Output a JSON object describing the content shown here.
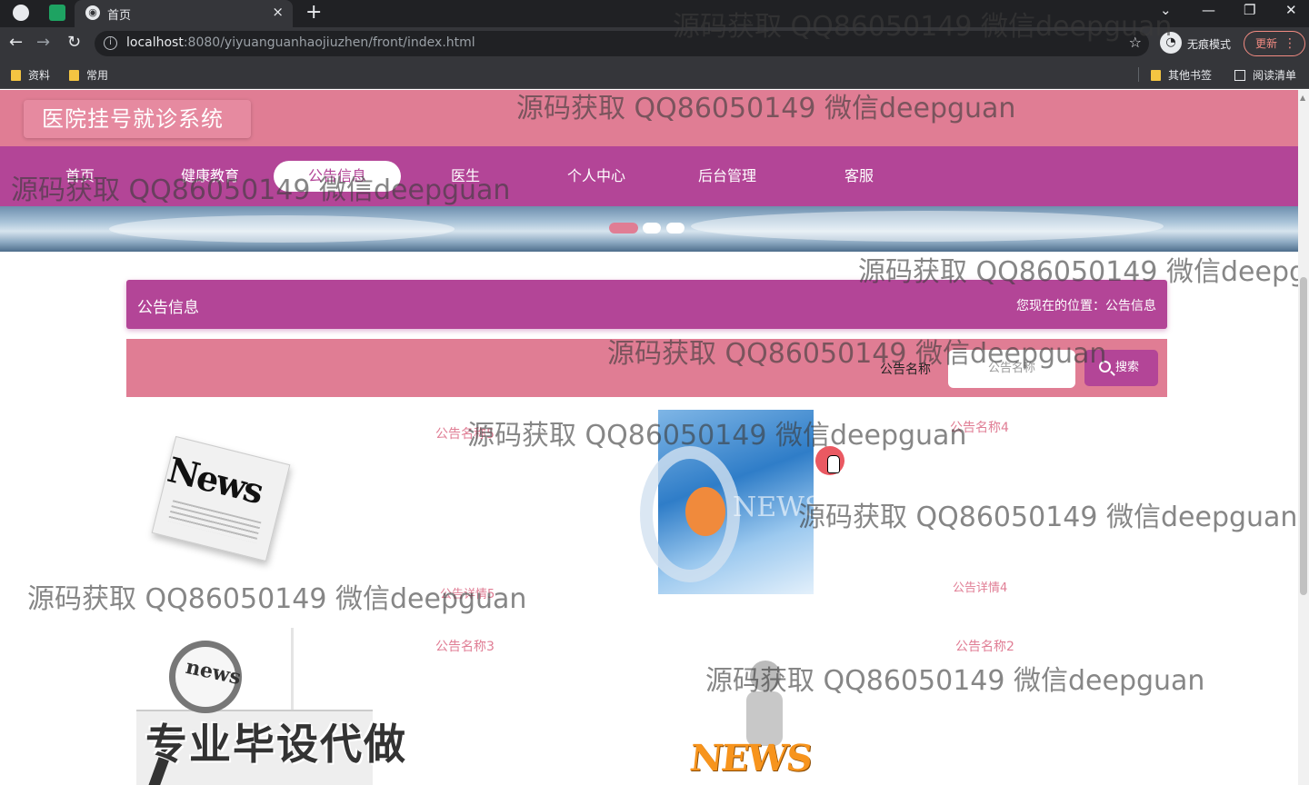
{
  "browser": {
    "tab_title": "首页",
    "tab_close": "×",
    "new_tab": "+",
    "window_controls": [
      "⌄",
      "—",
      "❐",
      "✕"
    ],
    "nav": {
      "back": "←",
      "forward": "→",
      "reload": "↻"
    },
    "url_host": "localhost",
    "url_path": ":8080/yiyuanguanhaojiuzhen/front/index.html",
    "star": "☆",
    "incognito_label": "无痕模式",
    "update_label": "更新",
    "bookmarks": [
      "资料",
      "常用"
    ],
    "other_bookmarks": "其他书签",
    "reading_list": "阅读清单"
  },
  "site": {
    "logo": "医院挂号就诊系统",
    "nav_items": [
      "首页",
      "健康教育",
      "公告信息",
      "医生",
      "个人中心",
      "后台管理",
      "客服"
    ],
    "active_nav": "公告信息"
  },
  "section": {
    "title": "公告信息",
    "breadcrumb": "您现在的位置：公告信息"
  },
  "search": {
    "label": "公告名称",
    "placeholder": "公告名称",
    "button": "搜索"
  },
  "notices": [
    {
      "name": "公告名称5",
      "detail": "公告详情5",
      "image_text": "News"
    },
    {
      "name": "公告名称4",
      "detail": "公告详情4",
      "image_text": "NEWS"
    },
    {
      "name": "公告名称3",
      "image_text": "news"
    },
    {
      "name": "公告名称2",
      "image_text": "NEWS"
    }
  ],
  "overlay_text": "专业毕设代做",
  "watermark": "源码获取 QQ86050149 微信deepguan",
  "colors": {
    "header_pink": "#e07d94",
    "nav_purple": "#b34597",
    "accent": "#b34597"
  }
}
